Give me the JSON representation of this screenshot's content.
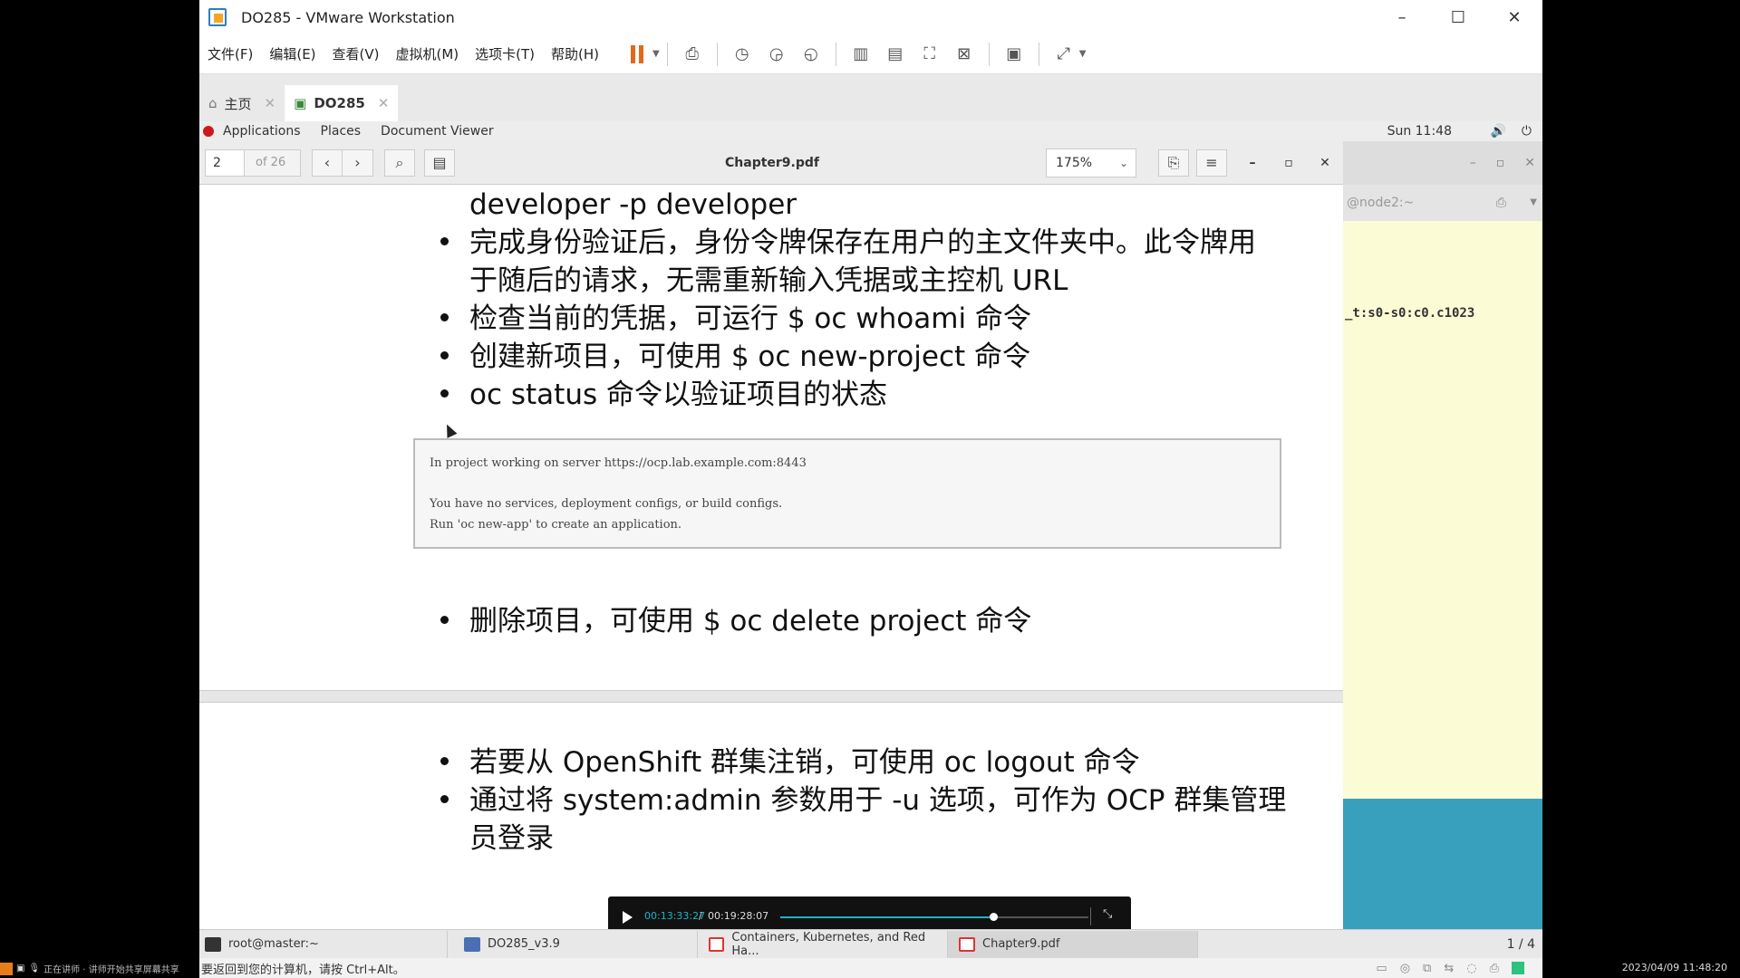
{
  "vmware": {
    "title": "DO285 - VMware Workstation",
    "menu": [
      "文件(F)",
      "编辑(E)",
      "查看(V)",
      "虚拟机(M)",
      "选项卡(T)",
      "帮助(H)"
    ],
    "tabs": [
      {
        "label": "主页"
      },
      {
        "label": "DO285"
      }
    ]
  },
  "gnome": {
    "applications": "Applications",
    "places": "Places",
    "app_name": "Document Viewer",
    "clock": "Sun 11:48"
  },
  "viewer": {
    "page_number": "2",
    "page_of": "of 26",
    "filename": "Chapter9.pdf",
    "zoom": "175%"
  },
  "page1": {
    "line0": "developer -p developer",
    "bullet1_line1": "完成身份验证后，身份令牌保存在用户的主文件夹中。此令牌用",
    "bullet1_line2": "于随后的请求，无需重新输入凭据或主控机 URL",
    "bullet2": "检查当前的凭据，可运行 $ oc whoami 命令",
    "bullet3": "创建新项目，可使用 $ oc new-project 命令",
    "bullet4": "oc status 命令以验证项目的状态",
    "code": [
      "In project working on server https://ocp.lab.example.com:8443",
      "You have no services, deployment configs, or build configs.",
      "Run 'oc new-app' to create an application."
    ],
    "bullet5": "删除项目，可使用 $ oc delete project 命令"
  },
  "page2": {
    "bullet1": "若要从 OpenShift 群集注销，可使用 oc logout 命令",
    "bullet2_line1": "通过将 system:admin 参数用于 -u 选项，可作为 OCP 群集管理",
    "bullet2_line2": "员登录"
  },
  "terminal": {
    "tab_label": "@node2:~",
    "line": "_t:s0-s0:c0.c1023"
  },
  "player": {
    "current_time": "00:13:33:27",
    "separator": "/",
    "total_time": "00:19:28:07",
    "progress": 0.69,
    "accent": "#19b6c9"
  },
  "taskbar": {
    "items": [
      "root@master:~",
      "DO285_v3.9",
      "Containers, Kubernetes, and Red Ha...",
      "Chapter9.pdf"
    ],
    "pages": "1 / 4"
  },
  "status": {
    "message": "要返回到您的计算机，请按 Ctrl+Alt。"
  },
  "host": {
    "left_text": "正在讲师 · 讲师开始共享屏幕共享",
    "datetime": "2023/04/09 11:48:20"
  }
}
